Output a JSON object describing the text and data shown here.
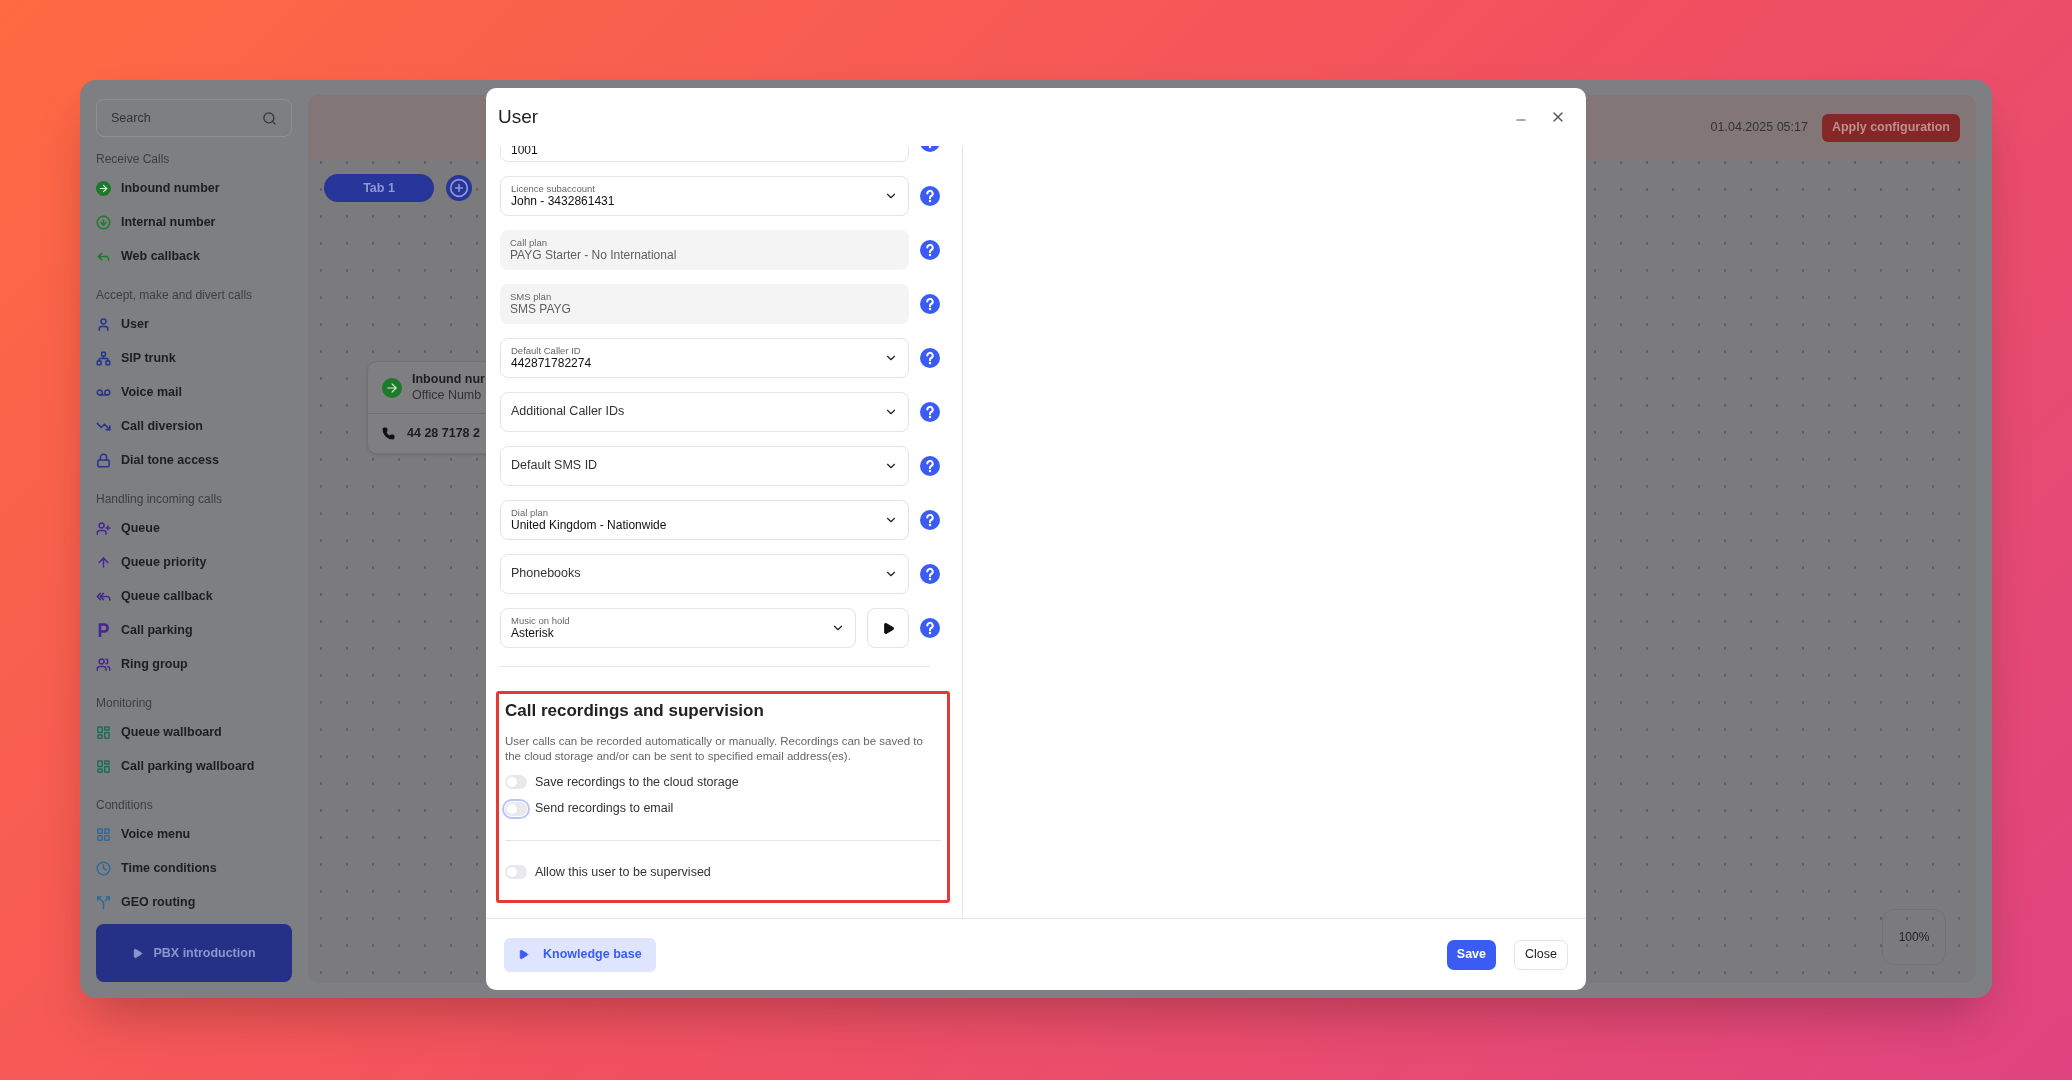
{
  "sidebar": {
    "search": {
      "placeholder": "Search"
    },
    "sections": [
      {
        "title": "Receive Calls",
        "items": [
          {
            "label": "Inbound number"
          },
          {
            "label": "Internal number"
          },
          {
            "label": "Web callback"
          }
        ]
      },
      {
        "title": "Accept, make and divert calls",
        "items": [
          {
            "label": "User"
          },
          {
            "label": "SIP trunk"
          },
          {
            "label": "Voice mail"
          },
          {
            "label": "Call diversion"
          },
          {
            "label": "Dial tone access"
          }
        ]
      },
      {
        "title": "Handling incoming calls",
        "items": [
          {
            "label": "Queue"
          },
          {
            "label": "Queue priority"
          },
          {
            "label": "Queue callback"
          },
          {
            "label": "Call parking"
          },
          {
            "label": "Ring group"
          }
        ]
      },
      {
        "title": "Monitoring",
        "items": [
          {
            "label": "Queue wallboard"
          },
          {
            "label": "Call parking wallboard"
          }
        ]
      },
      {
        "title": "Conditions",
        "items": [
          {
            "label": "Voice menu"
          },
          {
            "label": "Time conditions"
          },
          {
            "label": "GEO routing"
          }
        ]
      }
    ],
    "intro_button": "PBX introduction"
  },
  "top_bar": {
    "timestamp": "01.04.2025 05:17",
    "apply_button": "Apply configuration"
  },
  "tabs": [
    {
      "label": "Tab 1",
      "selected": true
    }
  ],
  "canvas": {
    "node": {
      "title": "Inbound nur",
      "subtitle": "Office Numb",
      "number": "44 28 7178 2"
    },
    "zoom": "100%"
  },
  "modal": {
    "title": "User",
    "fields": [
      {
        "kind": "text",
        "value": "1001",
        "disabled": false
      },
      {
        "kind": "select",
        "label": "Licence subaccount",
        "value": "John - 3432861431",
        "disabled": false
      },
      {
        "kind": "select",
        "label": "Call plan",
        "value": "PAYG Starter - No International",
        "disabled": true
      },
      {
        "kind": "select",
        "label": "SMS plan",
        "value": "SMS PAYG",
        "disabled": true
      },
      {
        "kind": "select",
        "label": "Default Caller ID",
        "value": "442871782274",
        "disabled": false
      },
      {
        "kind": "select",
        "placeholder": "Additional Caller IDs",
        "disabled": false
      },
      {
        "kind": "select",
        "placeholder": "Default SMS ID",
        "disabled": false
      },
      {
        "kind": "select",
        "label": "Dial plan",
        "value": "United Kingdom - Nationwide",
        "disabled": false
      },
      {
        "kind": "select",
        "placeholder": "Phonebooks",
        "disabled": false
      },
      {
        "kind": "audio",
        "label": "Music on hold",
        "value": "Asterisk",
        "disabled": false
      }
    ],
    "recordings": {
      "title": "Call recordings and supervision",
      "description": "User calls can be recorded automatically or manually. Recordings can be saved to the cloud storage and/or can be sent to specified email address(es).",
      "toggles": [
        {
          "label": "Save recordings to the cloud storage",
          "on": false,
          "focused": false
        },
        {
          "label": "Send recordings to email",
          "on": false,
          "focused": true
        }
      ],
      "supervision": {
        "label": "Allow this user to be supervised",
        "on": false,
        "focused": false
      }
    },
    "footer": {
      "knowledge_button": "Knowledge base",
      "save_button": "Save",
      "close_button": "Close"
    }
  }
}
